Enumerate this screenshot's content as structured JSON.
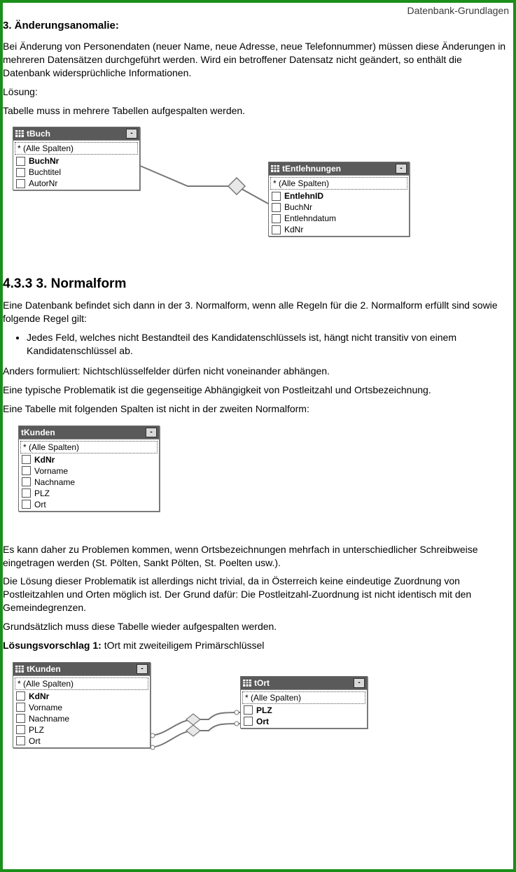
{
  "header": {
    "running": "Datenbank-Grundlagen"
  },
  "s1": {
    "title": "3. Änderungsanomalie:",
    "p1": "Bei Änderung von Personendaten (neuer Name, neue Adresse, neue Telefonnummer) müssen diese Änderungen in mehreren Datensätzen durchgeführt werden. Wird ein betroffener Datensatz nicht geändert, so enthält die Datenbank widersprüchliche Informationen.",
    "p2": "Lösung:",
    "p3": "Tabelle muss in mehrere Tabellen aufgespalten werden."
  },
  "diag1": {
    "tBuch": {
      "title": "tBuch",
      "rows": [
        {
          "label": "* (Alle Spalten)",
          "bold": false,
          "all": true
        },
        {
          "label": "BuchNr",
          "bold": true,
          "all": false
        },
        {
          "label": "Buchtitel",
          "bold": false,
          "all": false
        },
        {
          "label": "AutorNr",
          "bold": false,
          "all": false
        }
      ]
    },
    "tEntlehnungen": {
      "title": "tEntlehnungen",
      "rows": [
        {
          "label": "* (Alle Spalten)",
          "bold": false,
          "all": true
        },
        {
          "label": "EntlehnID",
          "bold": true,
          "all": false
        },
        {
          "label": "BuchNr",
          "bold": false,
          "all": false
        },
        {
          "label": "Entlehndatum",
          "bold": false,
          "all": false
        },
        {
          "label": "KdNr",
          "bold": false,
          "all": false
        }
      ]
    }
  },
  "s2": {
    "title": "4.3.3 3. Normalform",
    "p1": "Eine Datenbank befindet sich dann in der 3. Normalform, wenn alle Regeln für die 2. Normalform erfüllt sind sowie folgende Regel gilt:",
    "bullet1": "Jedes Feld, welches nicht Bestandteil des Kandidatenschlüssels ist, hängt nicht transitiv von einem Kandidatenschlüssel ab.",
    "p2": "Anders formuliert: Nichtschlüsselfelder dürfen nicht voneinander abhängen.",
    "p3": "Eine typische Problematik ist die gegenseitige Abhängigkeit von Postleitzahl und Ortsbezeichnung.",
    "p4": "Eine Tabelle mit folgenden Spalten ist nicht in der zweiten Normalform:"
  },
  "diag2": {
    "tKunden": {
      "title": "tKunden",
      "rows": [
        {
          "label": "* (Alle Spalten)",
          "bold": false,
          "all": true
        },
        {
          "label": "KdNr",
          "bold": true,
          "all": false
        },
        {
          "label": "Vorname",
          "bold": false,
          "all": false
        },
        {
          "label": "Nachname",
          "bold": false,
          "all": false
        },
        {
          "label": "PLZ",
          "bold": false,
          "all": false
        },
        {
          "label": "Ort",
          "bold": false,
          "all": false
        }
      ]
    }
  },
  "s3": {
    "p1": "Es kann daher zu Problemen kommen, wenn Ortsbezeichnungen mehrfach in unterschiedlicher Schreibweise eingetragen werden (St. Pölten, Sankt Pölten, St. Poelten usw.).",
    "p2": "Die Lösung dieser Problematik ist allerdings nicht trivial, da in Österreich keine eindeutige Zuordnung von Postleitzahlen und Orten möglich ist. Der Grund dafür: Die Postleitzahl-Zuordnung ist nicht identisch mit den Gemeindegrenzen.",
    "p3": "Grundsätzlich muss diese Tabelle wieder aufgespalten werden.",
    "p4a": "Lösungsvorschlag 1:",
    "p4b": " tOrt mit zweiteiligem Primärschlüssel"
  },
  "diag3": {
    "tKunden": {
      "title": "tKunden",
      "rows": [
        {
          "label": "* (Alle Spalten)",
          "bold": false,
          "all": true
        },
        {
          "label": "KdNr",
          "bold": true,
          "all": false
        },
        {
          "label": "Vorname",
          "bold": false,
          "all": false
        },
        {
          "label": "Nachname",
          "bold": false,
          "all": false
        },
        {
          "label": "PLZ",
          "bold": false,
          "all": false
        },
        {
          "label": "Ort",
          "bold": false,
          "all": false
        }
      ]
    },
    "tOrt": {
      "title": "tOrt",
      "rows": [
        {
          "label": "* (Alle Spalten)",
          "bold": false,
          "all": true
        },
        {
          "label": "PLZ",
          "bold": true,
          "all": false
        },
        {
          "label": "Ort",
          "bold": true,
          "all": false
        }
      ]
    }
  }
}
